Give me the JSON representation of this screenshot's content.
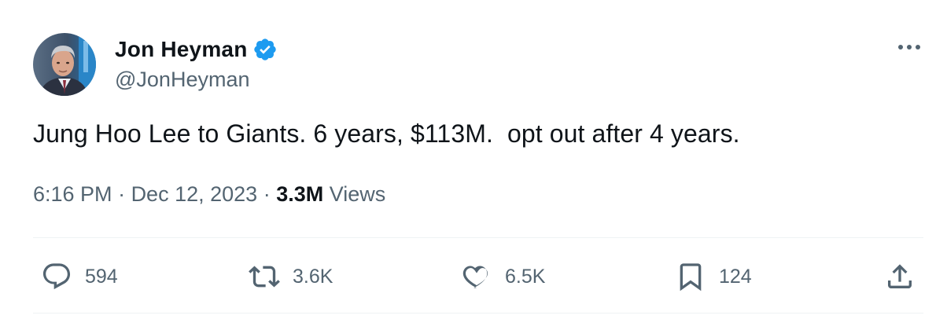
{
  "author": {
    "display_name": "Jon Heyman",
    "handle": "@JonHeyman",
    "verified": true
  },
  "tweet": {
    "text": "Jung Hoo Lee to Giants. 6 years, $113M.  opt out after 4 years.",
    "time": "6:16 PM",
    "separator": " · ",
    "date": "Dec 12, 2023",
    "views_count": "3.3M",
    "views_label": " Views"
  },
  "actions": {
    "replies": "594",
    "retweets": "3.6K",
    "likes": "6.5K",
    "bookmarks": "124"
  },
  "colors": {
    "text_primary": "#0f1419",
    "text_secondary": "#536471",
    "verified_blue": "#1d9bf0",
    "divider": "#eff3f4"
  },
  "icons": {
    "more": "more-horizontal-icon",
    "reply": "reply-icon",
    "retweet": "retweet-icon",
    "like": "heart-icon",
    "bookmark": "bookmark-icon",
    "share": "share-icon",
    "verified": "verified-badge-icon"
  }
}
